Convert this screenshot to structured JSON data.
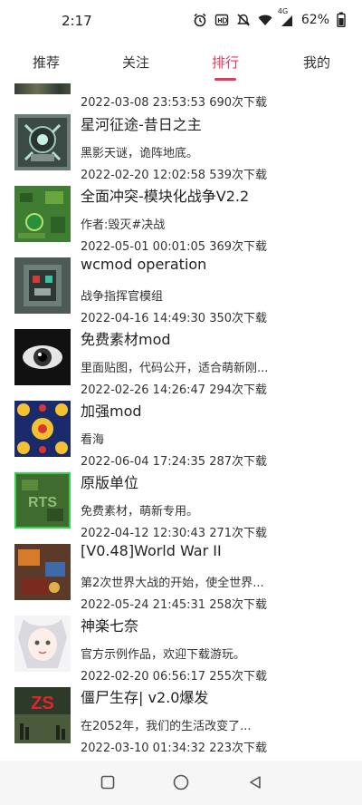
{
  "status": {
    "time": "2:17",
    "network": "4G",
    "battery": "62%"
  },
  "tabs": [
    {
      "label": "推荐"
    },
    {
      "label": "关注"
    },
    {
      "label": "排行"
    },
    {
      "label": "我的"
    }
  ],
  "active_tab": "排行",
  "first_time": "2022-03-08 23:53:53 690次下载",
  "items": [
    {
      "title": "星河征途-昔日之主",
      "desc": "黑影天谜，诡阵地底。",
      "time": "2022-02-20 12:02:58 539次下载"
    },
    {
      "title": "全面冲突-模块化战争V2.2",
      "desc": "作者:毁灭#决战",
      "time": "2022-05-01 00:01:05 369次下载"
    },
    {
      "title": "wcmod operation",
      "desc": "战争指挥官模组",
      "time": "2022-04-16 14:49:30 350次下载"
    },
    {
      "title": "免费素材mod",
      "desc": "里面贴图，代码公开，适合萌新刚...",
      "time": "2022-02-26 14:26:47 294次下载"
    },
    {
      "title": "加强mod",
      "desc": "看海",
      "time": "2022-06-04 17:24:35 287次下载"
    },
    {
      "title": "原版单位",
      "desc": "免费素材，萌新专用。",
      "time": "2022-04-12 12:30:43 271次下载"
    },
    {
      "title": "[V0.48]World War II",
      "desc": "第2次世界大战的开始，使全世界...",
      "time": "2022-05-24 21:45:31 258次下载"
    },
    {
      "title": "神楽七奈",
      "desc": "官方示例作品，欢迎下载游玩。",
      "time": "2022-02-20 06:56:17 255次下载"
    },
    {
      "title": "僵尸生存| v2.0爆发",
      "desc": "在2052年，我们的生活改变了...",
      "time": "2022-03-10 01:34:32 223次下载"
    }
  ],
  "thumb_text": {
    "rts": "RTS",
    "zs": "ZS"
  },
  "colors": {
    "accent": "#e8365d"
  }
}
